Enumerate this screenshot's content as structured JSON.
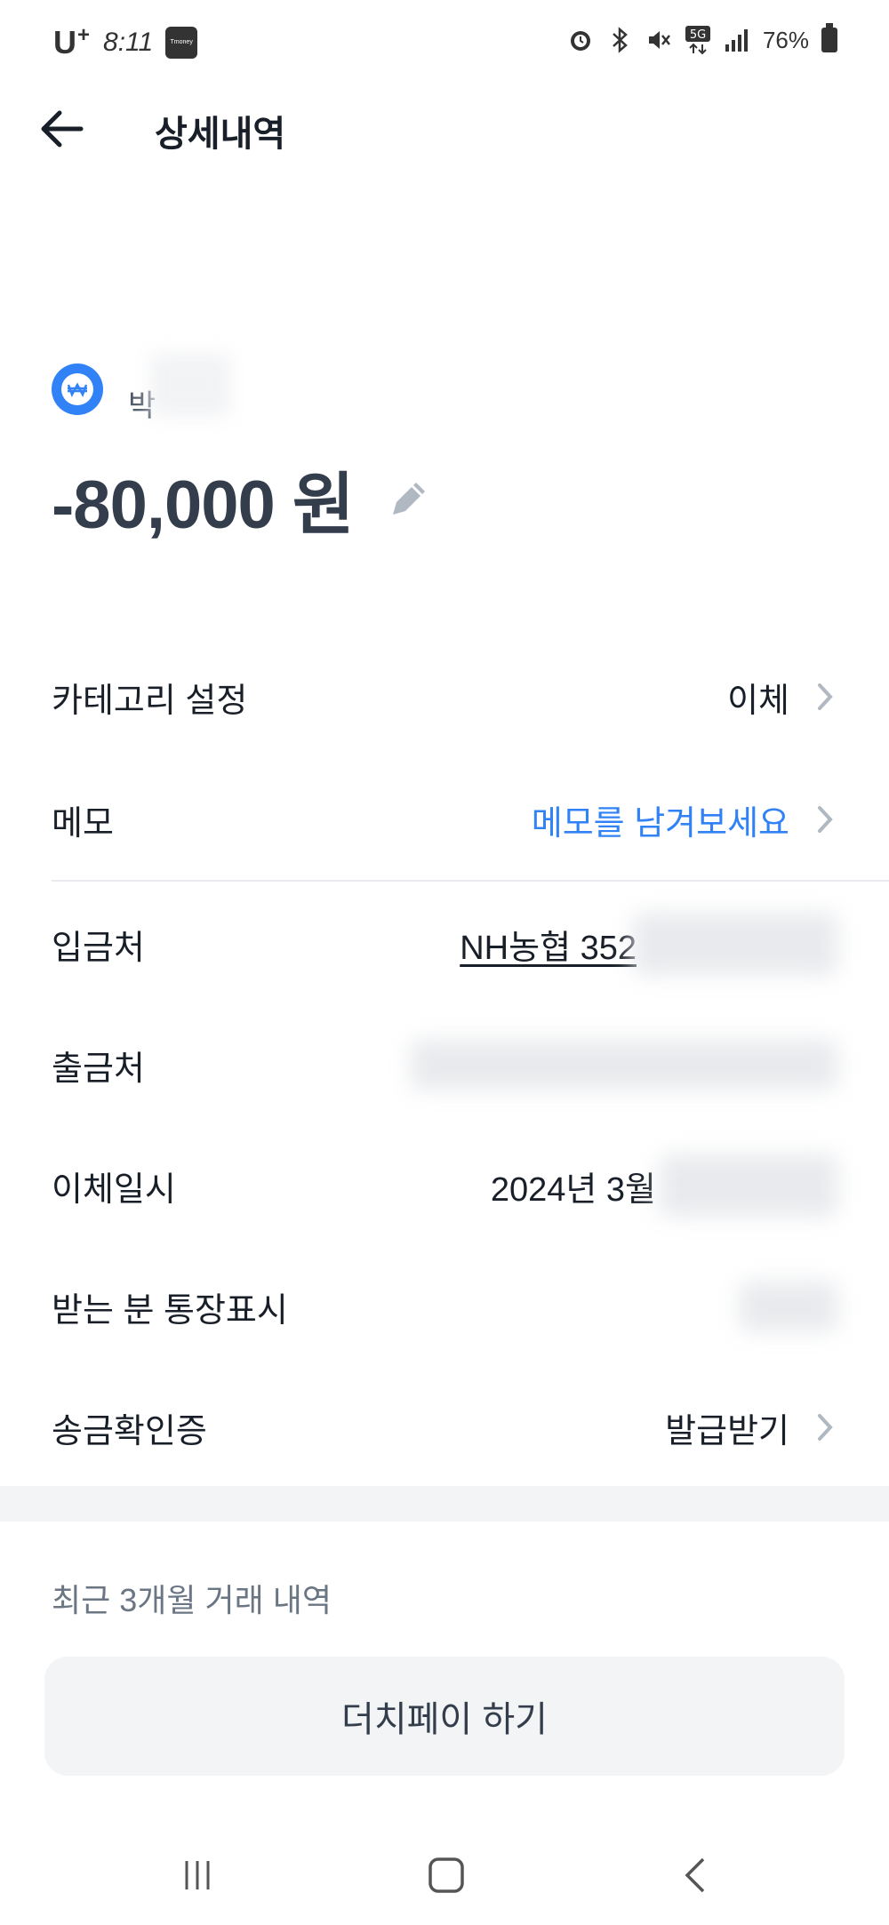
{
  "status_bar": {
    "carrier": "U",
    "carrier_plus": "+",
    "time": "8:11",
    "tmoney": "Tmoney",
    "battery": "76%"
  },
  "header": {
    "title": "상세내역"
  },
  "summary": {
    "counterparty_visible": "박",
    "amount": "-80,000 원"
  },
  "details": {
    "category": {
      "label": "카테고리 설정",
      "value": "이체"
    },
    "memo": {
      "label": "메모",
      "value": "메모를 남겨보세요"
    },
    "deposit_to": {
      "label": "입금처",
      "value": "NH농협 352"
    },
    "withdraw_from": {
      "label": "출금처"
    },
    "transfer_datetime": {
      "label": "이체일시",
      "value": "2024년 3월"
    },
    "recipient_display": {
      "label": "받는 분 통장표시"
    },
    "transfer_certificate": {
      "label": "송금확인증",
      "value": "발급받기"
    }
  },
  "recent": {
    "title": "최근 3개월 거래 내역",
    "dutch_pay_label": "더치페이 하기"
  },
  "colors": {
    "accent": "#3182f6",
    "text_primary": "#191f28",
    "text_secondary": "#6b7684",
    "button_bg": "#f2f4f6"
  }
}
